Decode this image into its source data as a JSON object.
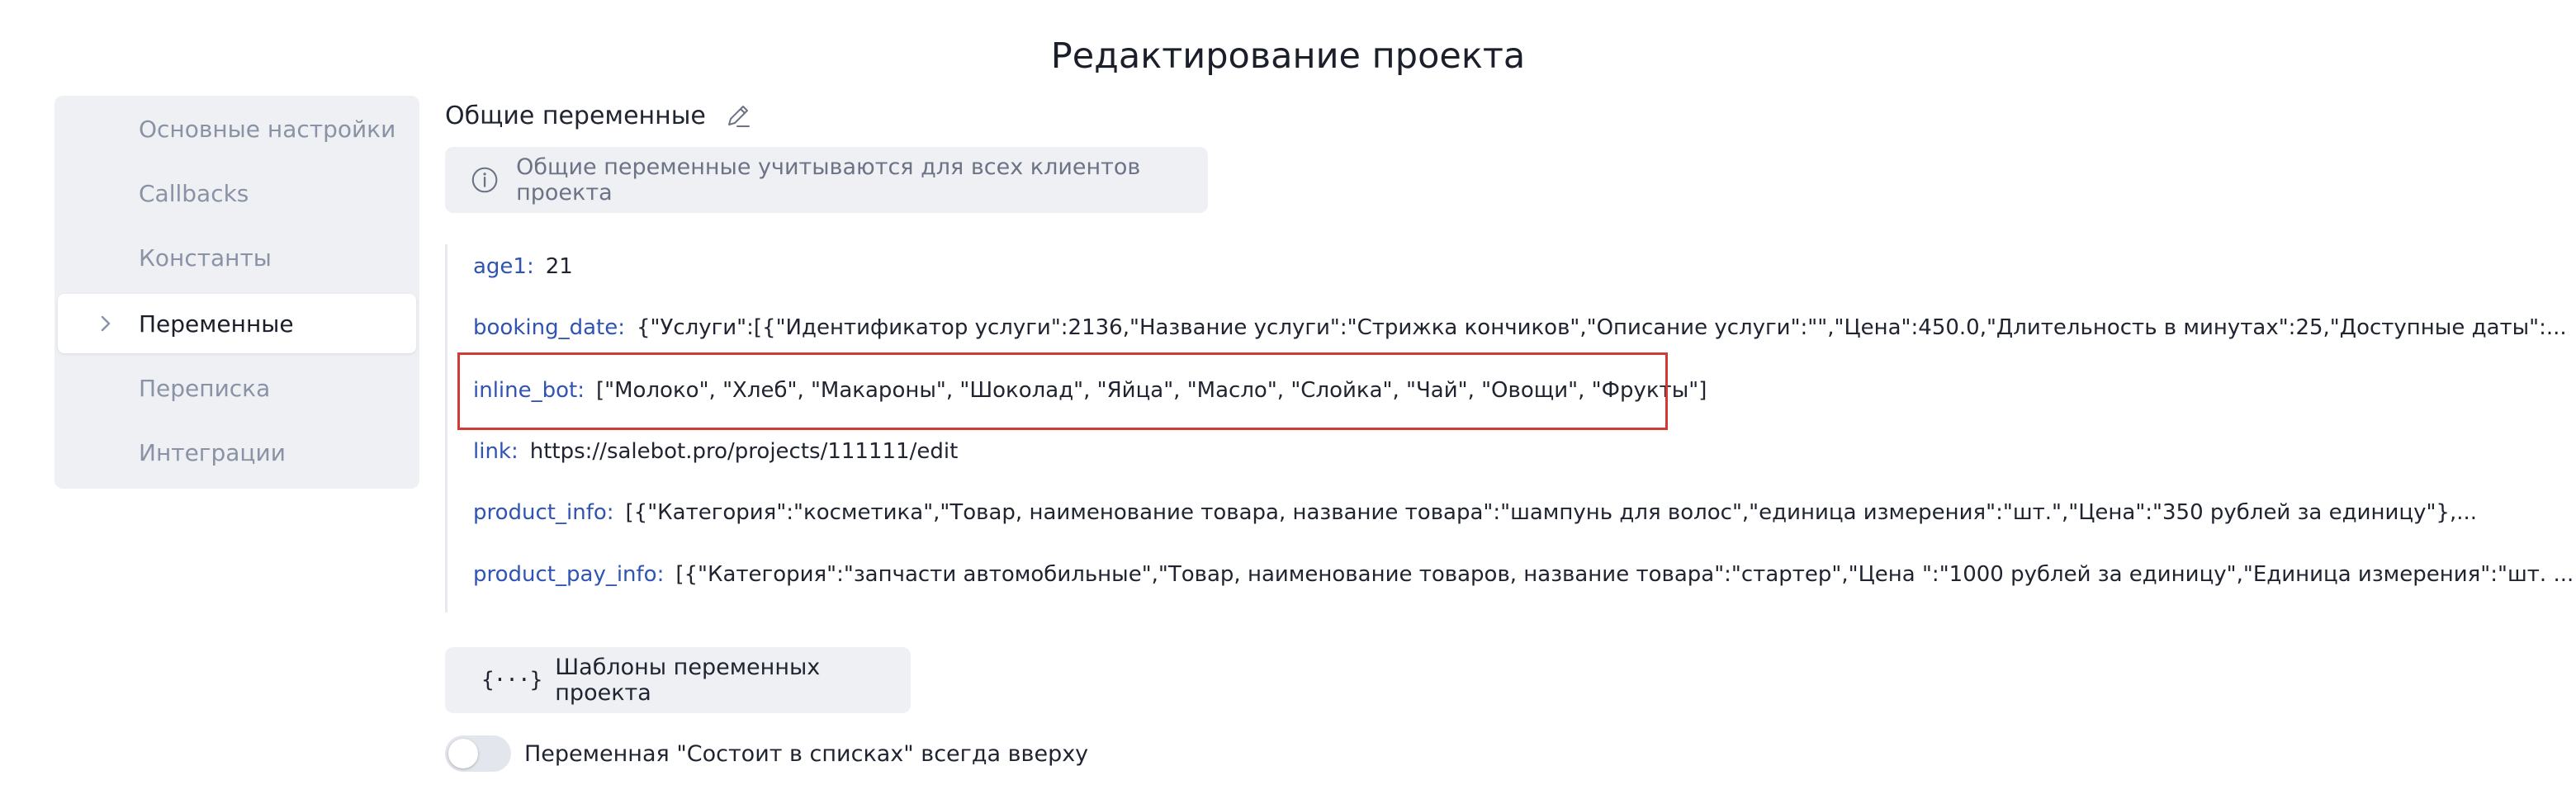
{
  "page": {
    "title": "Редактирование проекта"
  },
  "sidebar": {
    "items": [
      {
        "label": "Основные настройки",
        "active": false
      },
      {
        "label": "Callbacks",
        "active": false
      },
      {
        "label": "Константы",
        "active": false
      },
      {
        "label": "Переменные",
        "active": true
      },
      {
        "label": "Переписка",
        "active": false
      },
      {
        "label": "Интеграции",
        "active": false
      }
    ]
  },
  "section": {
    "title": "Общие переменные",
    "edit_icon": "pencil-icon",
    "info_icon": "info-circle-icon",
    "info_text": "Общие переменные учитываются для всех клиентов проекта"
  },
  "variables": [
    {
      "key": "age1:",
      "value": "21"
    },
    {
      "key": "booking_date:",
      "value": "{\"Услуги\":[{\"Идентификатор услуги\":2136,\"Название услуги\":\"Стрижка кончиков\",\"Описание услуги\":\"\",\"Цена\":450.0,\"Длительность в минутах\":25,\"Доступные даты\":..."
    },
    {
      "key": "inline_bot:",
      "value": "[\"Молоко\", \"Хлеб\", \"Макароны\", \"Шоколад\", \"Яйца\", \"Масло\", \"Слойка\", \"Чай\", \"Овощи\", \"Фрукты\"]",
      "highlighted": true
    },
    {
      "key": "link:",
      "value": "https://salebot.pro/projects/111111/edit"
    },
    {
      "key": "product_info:",
      "value": "[{\"Категория\":\"косметика\",\"Товар, наименование товара, название товара\":\"шампунь для волос\",\"единица измерения\":\"шт.\",\"Цена\":\"350 рублей за единицу\"},..."
    },
    {
      "key": "product_pay_info:",
      "value": "[{\"Категория\":\"запчасти автомобильные\",\"Товар, наименование товаров, название товара\":\"стартер\",\"Цена \":\"1000 рублей за единицу\",\"Единица измерения\":\"шт. ..."
    }
  ],
  "templates_button": {
    "icon": "{···}",
    "label": "Шаблоны переменных проекта"
  },
  "toggle": {
    "label": "Переменная \"Состоит в списках\" всегда вверху",
    "checked": false
  },
  "colors": {
    "accent_key": "#2f54b4",
    "highlight_border": "#d23b35",
    "panel_bg": "#eef0f4"
  }
}
